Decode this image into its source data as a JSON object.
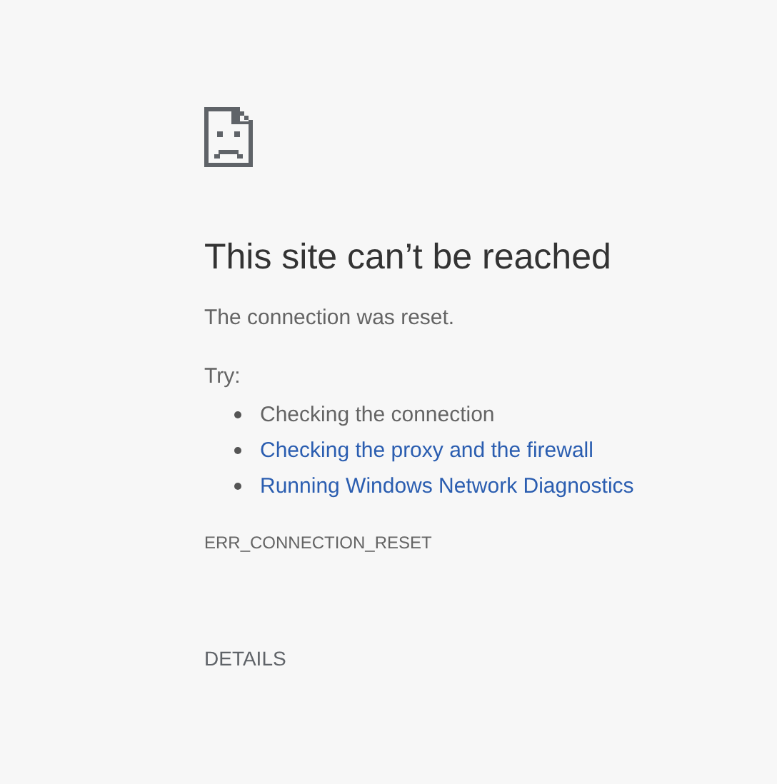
{
  "title": "This site can’t be reached",
  "message": "The connection was reset.",
  "try_label": "Try:",
  "suggestions": [
    {
      "text": "Checking the connection",
      "kind": "text"
    },
    {
      "text": "Checking the proxy and the firewall",
      "kind": "link"
    },
    {
      "text": "Running Windows Network Diagnostics",
      "kind": "link"
    }
  ],
  "error_code": "ERR_CONNECTION_RESET",
  "details_button": "DETAILS"
}
